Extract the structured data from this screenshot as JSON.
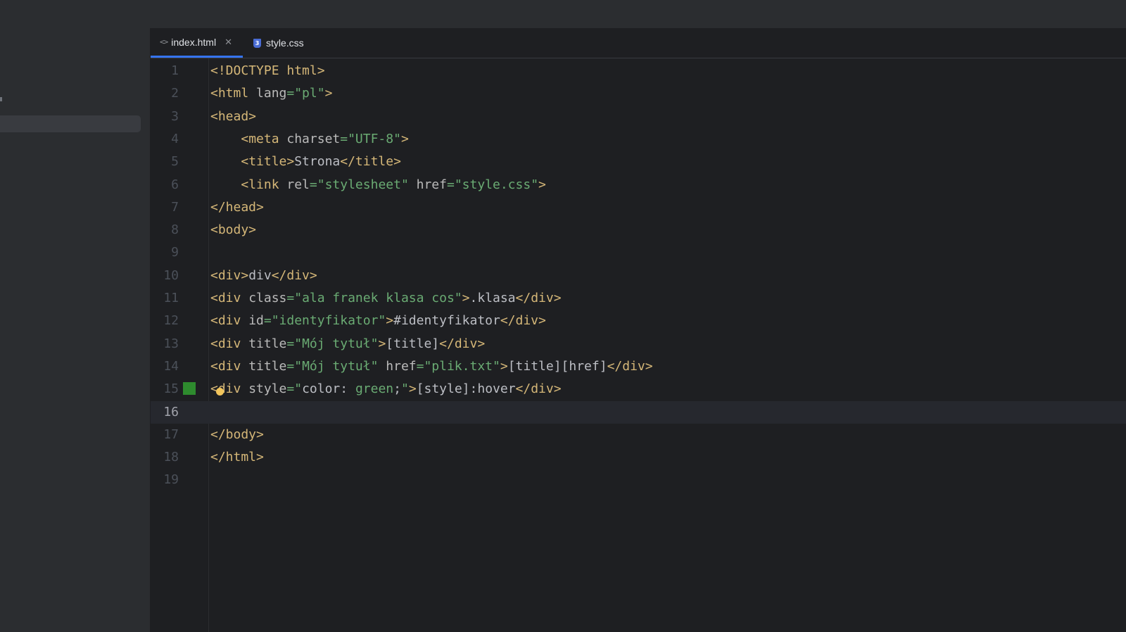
{
  "tabs": [
    {
      "label": "index.html",
      "icon": "html-file-icon",
      "active": true
    },
    {
      "label": "style.css",
      "icon": "css-file-icon",
      "active": false
    }
  ],
  "colors": {
    "accent": "#3574f0",
    "tag": "#d5b778",
    "string": "#6aab73",
    "swatch_green": "#2e8b2e"
  },
  "editor": {
    "current_line": 16,
    "lines": [
      {
        "n": "1",
        "tokens": [
          {
            "t": "tag",
            "v": "<!DOCTYPE html>"
          }
        ]
      },
      {
        "n": "2",
        "tokens": [
          {
            "t": "tag",
            "v": "<html"
          },
          {
            "t": "attr",
            "v": " lang"
          },
          {
            "t": "str",
            "v": "=\"pl\""
          },
          {
            "t": "tag",
            "v": ">"
          }
        ]
      },
      {
        "n": "3",
        "tokens": [
          {
            "t": "tag",
            "v": "<head>"
          }
        ]
      },
      {
        "n": "4",
        "tokens": [
          {
            "t": "txt",
            "v": "    "
          },
          {
            "t": "tag",
            "v": "<meta"
          },
          {
            "t": "attr",
            "v": " charset"
          },
          {
            "t": "str",
            "v": "=\"UTF-8\""
          },
          {
            "t": "tag",
            "v": ">"
          }
        ]
      },
      {
        "n": "5",
        "tokens": [
          {
            "t": "txt",
            "v": "    "
          },
          {
            "t": "tag",
            "v": "<title>"
          },
          {
            "t": "txt",
            "v": "Strona"
          },
          {
            "t": "tag",
            "v": "</title>"
          }
        ]
      },
      {
        "n": "6",
        "tokens": [
          {
            "t": "txt",
            "v": "    "
          },
          {
            "t": "tag",
            "v": "<link"
          },
          {
            "t": "attr",
            "v": " rel"
          },
          {
            "t": "str",
            "v": "=\"stylesheet\""
          },
          {
            "t": "attr",
            "v": " href"
          },
          {
            "t": "str",
            "v": "=\"style.css\""
          },
          {
            "t": "tag",
            "v": ">"
          }
        ]
      },
      {
        "n": "7",
        "tokens": [
          {
            "t": "tag",
            "v": "</head>"
          }
        ]
      },
      {
        "n": "8",
        "tokens": [
          {
            "t": "tag",
            "v": "<body>"
          }
        ]
      },
      {
        "n": "9",
        "tokens": []
      },
      {
        "n": "10",
        "tokens": [
          {
            "t": "tag",
            "v": "<div>"
          },
          {
            "t": "txt",
            "v": "div"
          },
          {
            "t": "tag",
            "v": "</div>"
          }
        ]
      },
      {
        "n": "11",
        "tokens": [
          {
            "t": "tag",
            "v": "<div"
          },
          {
            "t": "attr",
            "v": " class"
          },
          {
            "t": "str",
            "v": "=\"ala franek klasa cos\""
          },
          {
            "t": "tag",
            "v": ">"
          },
          {
            "t": "txt",
            "v": ".klasa"
          },
          {
            "t": "tag",
            "v": "</div>"
          }
        ]
      },
      {
        "n": "12",
        "tokens": [
          {
            "t": "tag",
            "v": "<div"
          },
          {
            "t": "attr",
            "v": " id"
          },
          {
            "t": "str",
            "v": "=\"identyfikator\""
          },
          {
            "t": "tag",
            "v": ">"
          },
          {
            "t": "txt",
            "v": "#identyfikator"
          },
          {
            "t": "tag",
            "v": "</div>"
          }
        ]
      },
      {
        "n": "13",
        "tokens": [
          {
            "t": "tag",
            "v": "<div"
          },
          {
            "t": "attr",
            "v": " title"
          },
          {
            "t": "str",
            "v": "=\"Mój tytuł\""
          },
          {
            "t": "tag",
            "v": ">"
          },
          {
            "t": "txt",
            "v": "[title]"
          },
          {
            "t": "tag",
            "v": "</div>"
          }
        ]
      },
      {
        "n": "14",
        "tokens": [
          {
            "t": "tag",
            "v": "<div"
          },
          {
            "t": "attr",
            "v": " title"
          },
          {
            "t": "str",
            "v": "=\"Mój tytuł\""
          },
          {
            "t": "attr",
            "v": " href"
          },
          {
            "t": "str",
            "v": "=\"plik.txt\""
          },
          {
            "t": "tag",
            "v": ">"
          },
          {
            "t": "txt",
            "v": "[title][href]"
          },
          {
            "t": "tag",
            "v": "</div>"
          }
        ]
      },
      {
        "n": "15",
        "swatch": true,
        "tokens": [
          {
            "t": "tag",
            "v": "<div"
          },
          {
            "t": "attr",
            "v": " style"
          },
          {
            "t": "str",
            "v": "=\""
          },
          {
            "t": "txt",
            "v": "color: "
          },
          {
            "t": "str",
            "v": "green"
          },
          {
            "t": "txt",
            "v": ";"
          },
          {
            "t": "str",
            "v": "\""
          },
          {
            "t": "tag",
            "v": ">"
          },
          {
            "t": "txt",
            "v": "[style]:hover"
          },
          {
            "t": "tag",
            "v": "</div>"
          }
        ]
      },
      {
        "n": "16",
        "tokens": []
      },
      {
        "n": "17",
        "tokens": [
          {
            "t": "tag",
            "v": "</body>"
          }
        ]
      },
      {
        "n": "18",
        "tokens": [
          {
            "t": "tag",
            "v": "</html>"
          }
        ]
      },
      {
        "n": "19",
        "tokens": []
      }
    ]
  }
}
